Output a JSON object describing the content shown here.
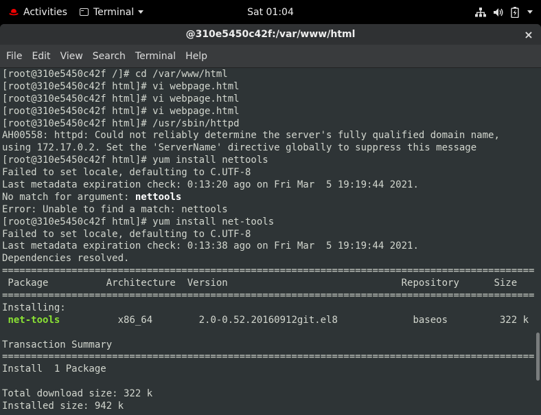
{
  "topbar": {
    "activities": "Activities",
    "app_menu": "Terminal",
    "clock": "Sat 01:04",
    "icons": [
      "network-icon",
      "volume-icon",
      "battery-icon",
      "system-menu-caret-icon"
    ]
  },
  "window": {
    "title": "@310e5450c42f:/var/www/html",
    "close": "×"
  },
  "menubar": {
    "items": [
      "File",
      "Edit",
      "View",
      "Search",
      "Terminal",
      "Help"
    ]
  },
  "terminal": {
    "lines": [
      "[root@310e5450c42f /]# cd /var/www/html",
      "[root@310e5450c42f html]# vi webpage.html",
      "[root@310e5450c42f html]# vi webpage.html",
      "[root@310e5450c42f html]# vi webpage.html",
      "[root@310e5450c42f html]# /usr/sbin/httpd",
      "AH00558: httpd: Could not reliably determine the server's fully qualified domain name,",
      "using 172.17.0.2. Set the 'ServerName' directive globally to suppress this message",
      "[root@310e5450c42f html]# yum install nettools",
      "Failed to set locale, defaulting to C.UTF-8",
      "Last metadata expiration check: 0:13:20 ago on Fri Mar  5 19:19:44 2021.",
      "No match for argument: ",
      "Error: Unable to find a match: nettools",
      "[root@310e5450c42f html]# yum install net-tools",
      "Failed to set locale, defaulting to C.UTF-8",
      "Last metadata expiration check: 0:13:38 ago on Fri Mar  5 19:19:44 2021.",
      "Dependencies resolved.",
      "================================================================================================",
      " Package          Architecture  Version                              Repository      Size",
      "================================================================================================",
      "Installing:",
      " ",
      "",
      "Transaction Summary",
      "================================================================================================",
      "Install  1 Package",
      "",
      "Total download size: 322 k",
      "Installed size: 942 k"
    ],
    "no_match_arg": "nettools",
    "pkg_name": "net-tools",
    "pkg_rest": "          x86_64        2.0-0.52.20160912git.el8             baseos         322 k"
  },
  "colors": {
    "terminal_bg": "#2e3436",
    "terminal_fg": "#d3d7cf",
    "package_green": "#8ae234"
  }
}
